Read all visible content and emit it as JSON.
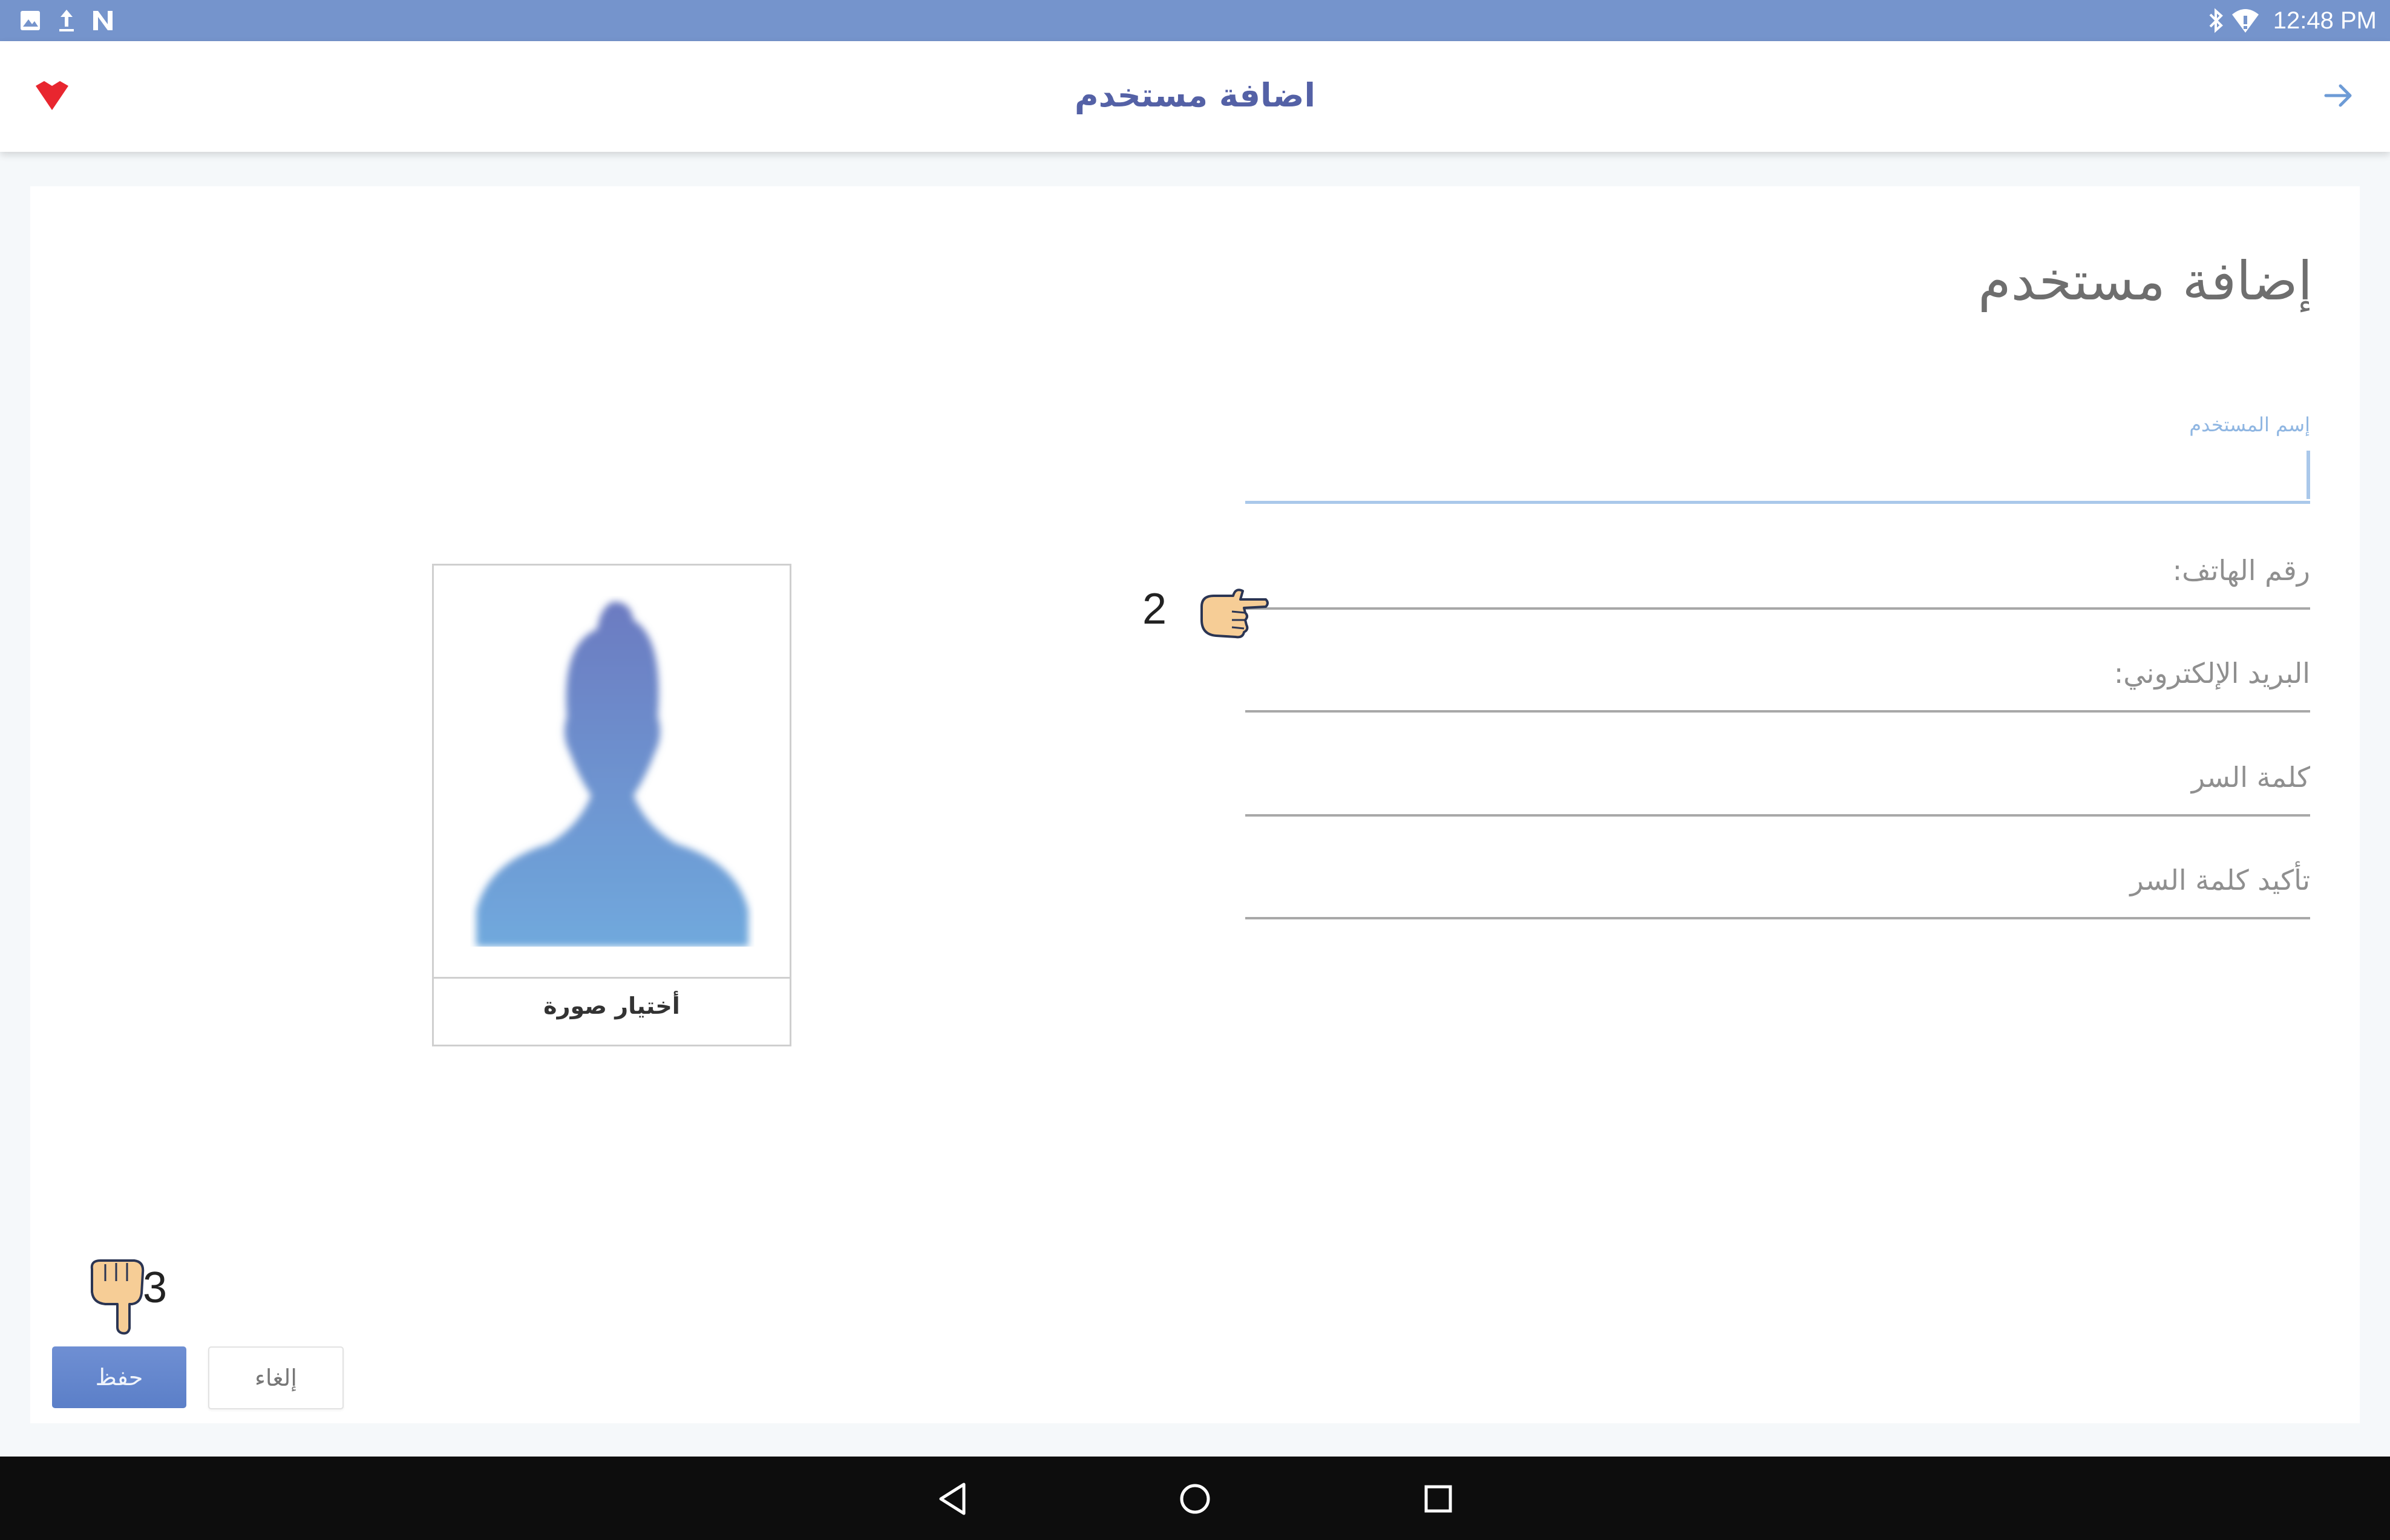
{
  "status_bar": {
    "time": "12:48 PM",
    "left_icons": [
      "image-icon",
      "upload-icon",
      "n-app-icon"
    ],
    "right_icons": [
      "bluetooth-icon",
      "wifi-icon"
    ]
  },
  "app_bar": {
    "title": "اضافة مستخدم",
    "back_icon": "arrow-right-icon",
    "logo_icon": "red-heart-logo-icon"
  },
  "form": {
    "heading": "إضافة مستخدم",
    "username_label": "إسم المستخدم",
    "phone_placeholder": "رقم الهاتف:",
    "email_placeholder": "البريد الإلكتروني:",
    "password_placeholder": "كلمة السر",
    "confirm_password_placeholder": "تأكيد كلمة السر"
  },
  "image_picker": {
    "label": "أختيار صورة",
    "avatar_icon": "person-silhouette-icon"
  },
  "hints": {
    "phone_hint_number": "2",
    "save_hint_number": "3"
  },
  "actions": {
    "save_label": "حفظ",
    "cancel_label": "إلغاء"
  },
  "colors": {
    "status_bar": "#7594cc",
    "accent": "#5461a6",
    "save_button": "#6584cb",
    "focus_line": "#aac8ea"
  },
  "nav_bar": {
    "icons": [
      "nav-back-icon",
      "nav-home-icon",
      "nav-recents-icon"
    ]
  }
}
